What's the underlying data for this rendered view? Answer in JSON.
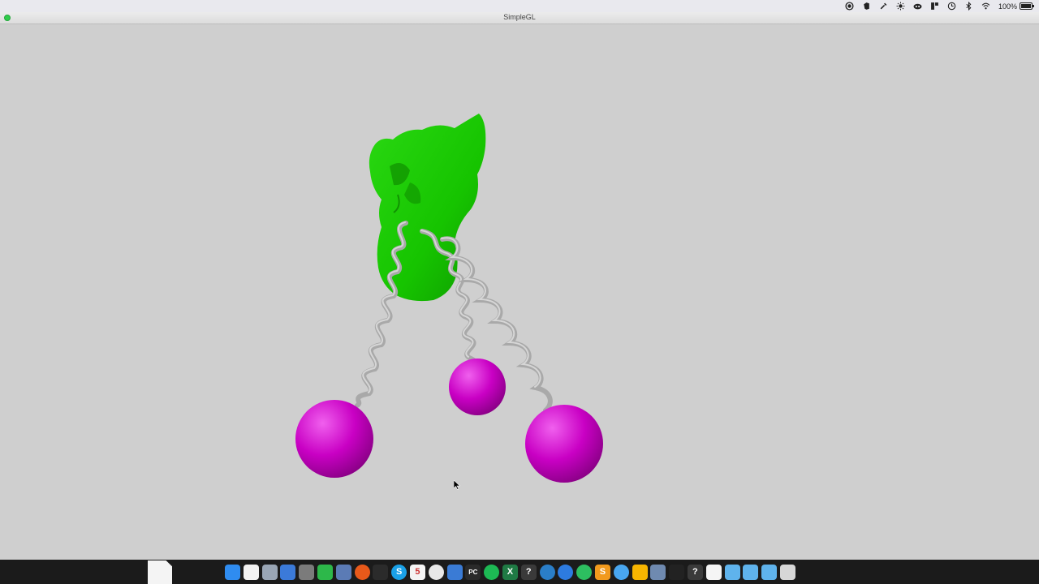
{
  "menubar": {
    "status_icons": [
      "record-icon",
      "evernote-icon",
      "eyedropper-icon",
      "brightness-icon",
      "creative-cloud-icon",
      "split-icon",
      "time-machine-icon",
      "bluetooth-icon",
      "wifi-icon"
    ],
    "battery_percent": "100%",
    "battery_icon": "battery-icon"
  },
  "window": {
    "title": "SimpleGL",
    "traffic_light_color": "#2fcc4a"
  },
  "scene": {
    "background_color": "#cfcfcf",
    "body_color": "#16c400",
    "spring_color": "#a9a9a9",
    "mass_color": "#c900c4",
    "objects": [
      "green-cat-model",
      "spring-left",
      "spring-middle",
      "spring-right",
      "mass-left",
      "mass-middle",
      "mass-right"
    ]
  },
  "dock": {
    "apps": [
      {
        "name": "finder-icon",
        "color": "#2f8cf0",
        "glyph": ""
      },
      {
        "name": "documents-icon",
        "color": "#f2f2f2",
        "glyph": ""
      },
      {
        "name": "preview-icon",
        "color": "#9aa6b5",
        "glyph": ""
      },
      {
        "name": "launchpad-icon",
        "color": "#3b7ad9",
        "glyph": ""
      },
      {
        "name": "system-preferences-icon",
        "color": "#7b7b7b",
        "glyph": ""
      },
      {
        "name": "facetime-icon",
        "color": "#2db84a",
        "glyph": ""
      },
      {
        "name": "image-capture-icon",
        "color": "#5b7bb5",
        "glyph": ""
      },
      {
        "name": "firefox-icon",
        "color": "#e8591a",
        "glyph": ""
      },
      {
        "name": "terminal-icon",
        "color": "#2b2b2b",
        "glyph": ""
      },
      {
        "name": "skype-icon",
        "color": "#1aa1e8",
        "glyph": "S"
      },
      {
        "name": "calendar-icon",
        "color": "#f4f4f4",
        "glyph": "5"
      },
      {
        "name": "chrome-icon",
        "color": "#e8e8e8",
        "glyph": ""
      },
      {
        "name": "xcode-icon",
        "color": "#3a7bd5",
        "glyph": ""
      },
      {
        "name": "pycharm-icon",
        "color": "#2a2a2a",
        "glyph": "PC"
      },
      {
        "name": "spotify-icon",
        "color": "#1db954",
        "glyph": ""
      },
      {
        "name": "excel-icon",
        "color": "#1f7a44",
        "glyph": "X"
      },
      {
        "name": "help-icon",
        "color": "#3a3a3a",
        "glyph": "?"
      },
      {
        "name": "edge-icon",
        "color": "#2a7ec8",
        "glyph": ""
      },
      {
        "name": "signal-icon",
        "color": "#2d7be0",
        "glyph": ""
      },
      {
        "name": "evernote-icon",
        "color": "#2dbe60",
        "glyph": ""
      },
      {
        "name": "sublime-icon",
        "color": "#f29a1d",
        "glyph": "S"
      },
      {
        "name": "messages-icon",
        "color": "#49a7f0",
        "glyph": ""
      },
      {
        "name": "sketch-icon",
        "color": "#f7b500",
        "glyph": ""
      },
      {
        "name": "remote-desktop-icon",
        "color": "#6f8ab0",
        "glyph": ""
      },
      {
        "name": "console-icon",
        "color": "#222222",
        "glyph": ""
      },
      {
        "name": "help-viewer-icon",
        "color": "#3a3a3a",
        "glyph": "?"
      },
      {
        "name": "file-icon",
        "color": "#f5f5f5",
        "glyph": ""
      },
      {
        "name": "folder-downloads-icon",
        "color": "#5fb3ec",
        "glyph": ""
      },
      {
        "name": "folder-icon",
        "color": "#5fb3ec",
        "glyph": ""
      },
      {
        "name": "folder-applications-icon",
        "color": "#5fb3ec",
        "glyph": ""
      },
      {
        "name": "trash-icon",
        "color": "#d7d7d7",
        "glyph": ""
      }
    ]
  }
}
